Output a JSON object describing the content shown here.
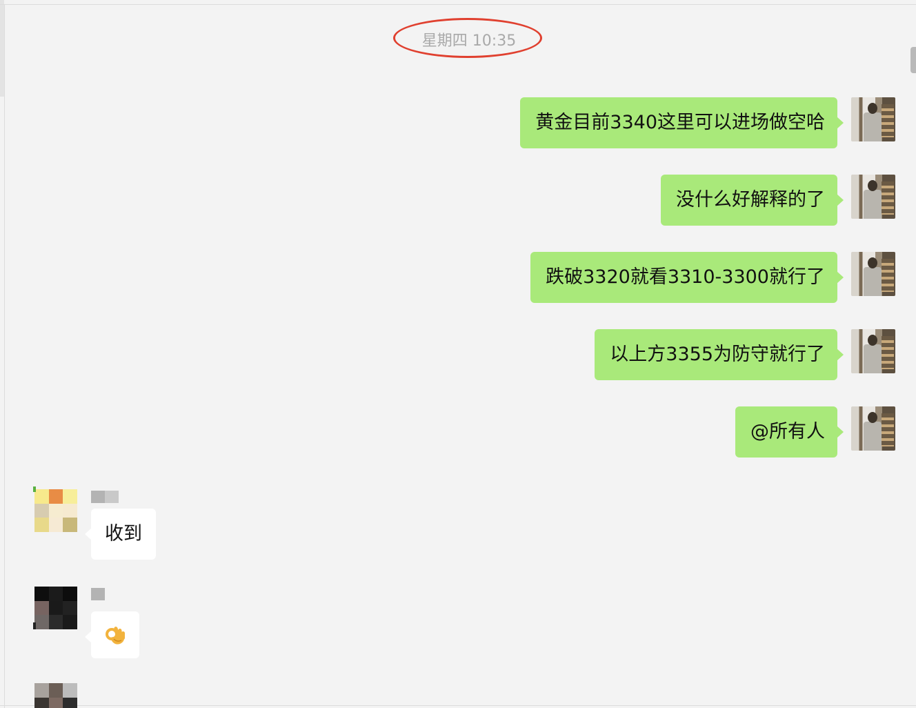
{
  "timestamp": "星期四 10:35",
  "outgoing_messages": [
    {
      "text": "黄金目前3340这里可以进场做空哈"
    },
    {
      "text": "没什么好解释的了"
    },
    {
      "text": "跌破3320就看3310-3300就行了"
    },
    {
      "text": "以上方3355为防守就行了"
    },
    {
      "text": "@所有人"
    }
  ],
  "incoming_messages": [
    {
      "text": "收到",
      "avatar_colors": [
        "#f7e98c",
        "#e88c45",
        "#f7ee9a",
        "#d7ccb0",
        "#f6ecd0",
        "#f6ead0",
        "#e8d98a",
        "#f6ead4",
        "#c8b87a"
      ],
      "name_blocks": [
        "#b3b3b3",
        "#c9c9c9"
      ]
    },
    {
      "emoji": "ok-hand",
      "avatar_colors": [
        "#0e0e0e",
        "#1b1b1b",
        "#0d0d0d",
        "#776461",
        "#1a1a1a",
        "#222222",
        "#6f6866",
        "#2b2b2b",
        "#1a1a1a"
      ],
      "name_blocks": [
        "#b3b3b3"
      ]
    },
    {
      "avatar_colors": [
        "#a8a29d",
        "#6b5e56",
        "#bcbcbc",
        "#3a3531",
        "#7d6a62",
        "#2c2c2c",
        "#f3f3f3",
        "#f3f3f3",
        "#f3f3f3"
      ],
      "name_blocks": []
    }
  ],
  "colors": {
    "background": "#f3f3f3",
    "outgoing_bubble": "#a9e97a",
    "incoming_bubble": "#ffffff",
    "timestamp_text": "#a9a9a9",
    "annotation_circle": "#e0402f"
  }
}
